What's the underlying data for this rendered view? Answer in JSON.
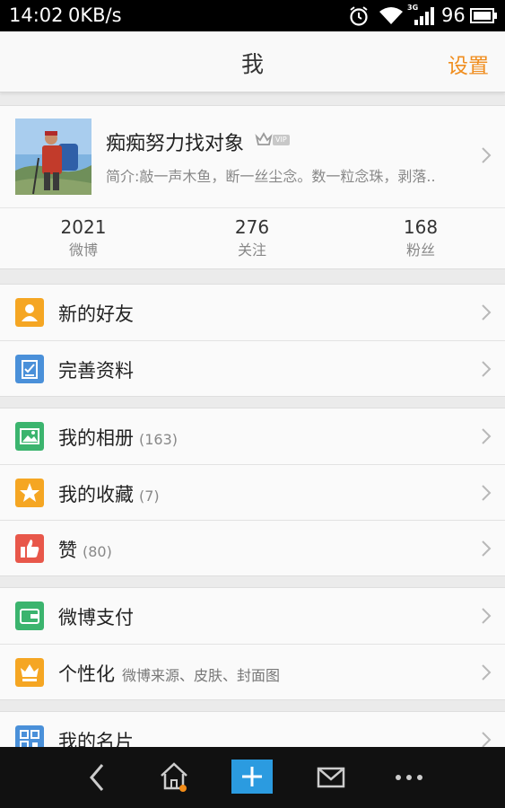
{
  "status_bar": {
    "time": "14:02",
    "speed": "0KB/s",
    "network": "3G",
    "battery": "96"
  },
  "header": {
    "title": "我",
    "settings_label": "设置"
  },
  "profile": {
    "name": "痴痴努力找对象",
    "vip_label": "VIP",
    "bio": "简介:敲一声木鱼，断一丝尘念。数一粒念珠，剥落..",
    "stats": [
      {
        "value": "2021",
        "label": "微博"
      },
      {
        "value": "276",
        "label": "关注"
      },
      {
        "value": "168",
        "label": "粉丝"
      }
    ]
  },
  "groups": [
    {
      "items": [
        {
          "label": "新的好友",
          "icon": "new-friend-icon",
          "color": "#f5a623"
        },
        {
          "label": "完善资料",
          "icon": "profile-edit-icon",
          "color": "#4a90d9"
        }
      ]
    },
    {
      "items": [
        {
          "label": "我的相册",
          "count": "(163)",
          "icon": "album-icon",
          "color": "#3bb46e"
        },
        {
          "label": "我的收藏",
          "count": "(7)",
          "icon": "star-icon",
          "color": "#f5a623"
        },
        {
          "label": "赞",
          "count": "(80)",
          "icon": "thumbs-up-icon",
          "color": "#e8574a"
        }
      ]
    },
    {
      "items": [
        {
          "label": "微博支付",
          "icon": "wallet-icon",
          "color": "#3bb46e"
        },
        {
          "label": "个性化",
          "subtitle": "微博来源、皮肤、封面图",
          "icon": "vip-crown-icon",
          "color": "#f5a623"
        }
      ]
    },
    {
      "items": [
        {
          "label": "我的名片",
          "icon": "qr-card-icon",
          "color": "#4a90d9"
        }
      ]
    }
  ],
  "bottom_nav": [
    "back-icon",
    "home-icon",
    "compose-icon",
    "mail-icon",
    "more-icon"
  ]
}
